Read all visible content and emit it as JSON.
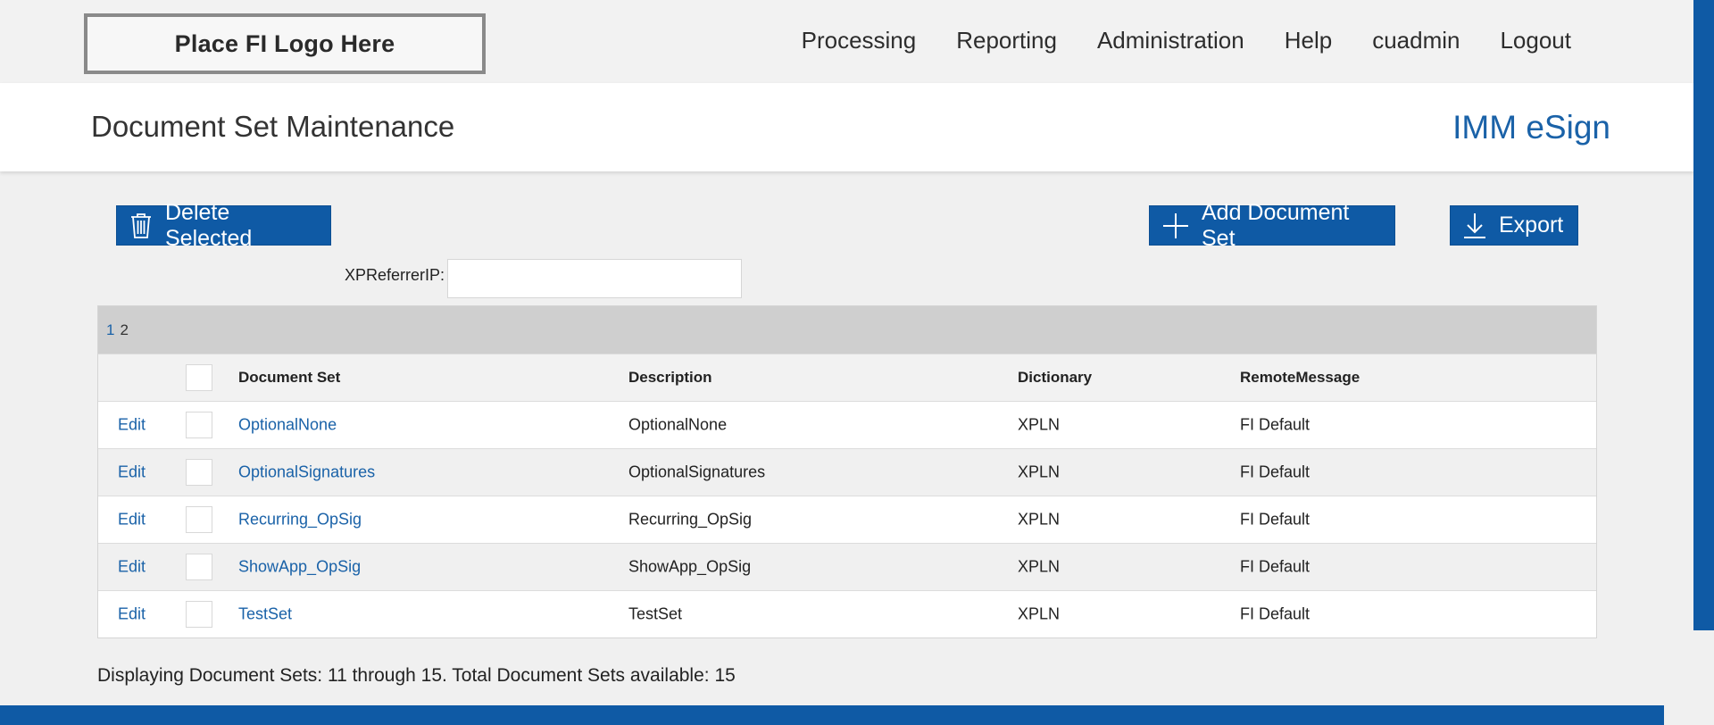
{
  "logo": {
    "text": "Place FI Logo Here"
  },
  "nav": {
    "items": [
      "Processing",
      "Reporting",
      "Administration",
      "Help",
      "cuadmin",
      "Logout"
    ]
  },
  "header": {
    "title": "Document Set Maintenance",
    "brand": "IMM eSign"
  },
  "toolbar": {
    "delete_label": "Delete Selected",
    "add_label": "Add Document Set",
    "export_label": "Export"
  },
  "filter": {
    "label": "XPReferrerIP:",
    "value": "",
    "placeholder": ""
  },
  "pager": {
    "pages": [
      "1",
      "2"
    ],
    "current": "2"
  },
  "table": {
    "columns": [
      "Document Set",
      "Description",
      "Dictionary",
      "RemoteMessage"
    ],
    "edit_label": "Edit",
    "rows": [
      {
        "set": "OptionalNone",
        "description": "OptionalNone",
        "dictionary": "XPLN",
        "remote": "FI Default"
      },
      {
        "set": "OptionalSignatures",
        "description": "OptionalSignatures",
        "dictionary": "XPLN",
        "remote": "FI Default"
      },
      {
        "set": "Recurring_OpSig",
        "description": "Recurring_OpSig",
        "dictionary": "XPLN",
        "remote": "FI Default"
      },
      {
        "set": "ShowApp_OpSig",
        "description": "ShowApp_OpSig",
        "dictionary": "XPLN",
        "remote": "FI Default"
      },
      {
        "set": "TestSet",
        "description": "TestSet",
        "dictionary": "XPLN",
        "remote": "FI Default"
      }
    ]
  },
  "footer": {
    "summary": "Displaying Document Sets: 11 through 15. Total Document Sets available: 15"
  },
  "colors": {
    "primary": "#0f5aa5",
    "link": "#1a62a8",
    "pager_bg": "#cfcfcf"
  },
  "icons": {
    "delete": "trash-icon",
    "add": "plus-icon",
    "export": "download-icon"
  }
}
